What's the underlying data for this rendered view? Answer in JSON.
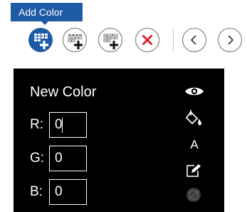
{
  "tooltip": {
    "text": "Add Color"
  },
  "toolbar": {
    "buttons": [
      {
        "name": "add-color-button",
        "icon": "add-color-icon",
        "active": true
      },
      {
        "name": "insert-color-button",
        "icon": "insert-color-icon"
      },
      {
        "name": "duplicate-color-button",
        "icon": "duplicate-color-icon"
      },
      {
        "name": "delete-color-button",
        "icon": "delete-icon"
      },
      {
        "name": "previous-button",
        "icon": "chevron-left-icon"
      },
      {
        "name": "next-button",
        "icon": "chevron-right-icon"
      }
    ]
  },
  "panel": {
    "title": "New Color",
    "fields": [
      {
        "label": "R:",
        "value": "0"
      },
      {
        "label": "G:",
        "value": "0"
      },
      {
        "label": "B:",
        "value": "0"
      }
    ],
    "side_icons": [
      {
        "name": "eye-icon"
      },
      {
        "name": "fill-bucket-icon"
      },
      {
        "name": "text-color-icon",
        "text": "A"
      },
      {
        "name": "edit-icon"
      },
      {
        "name": "disabled-circle-icon"
      }
    ]
  },
  "colors": {
    "accent": "#1f5aa6",
    "panel_bg": "#000000",
    "delete_red": "#d9252a",
    "button_border": "#8a8a8a"
  }
}
